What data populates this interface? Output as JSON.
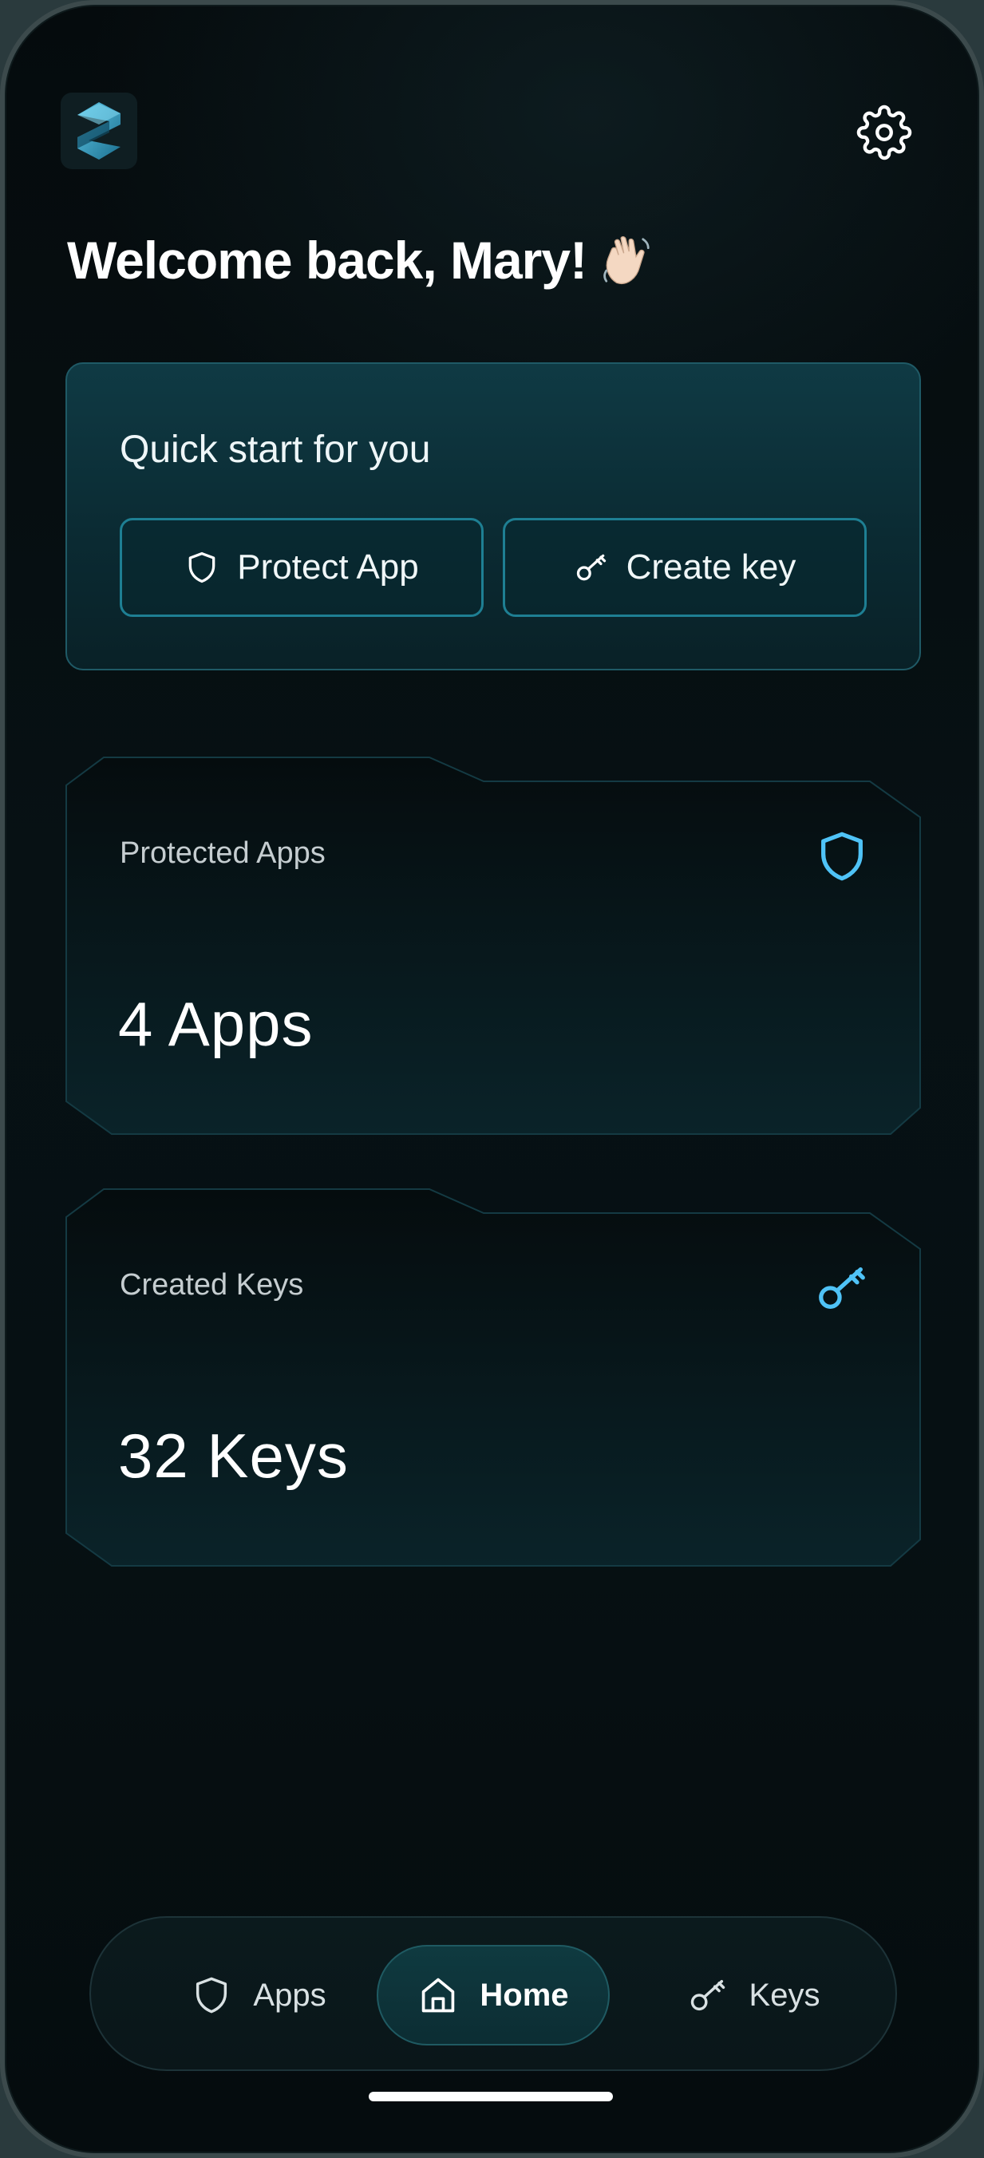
{
  "header": {
    "logo_icon": "shield-s-logo-icon",
    "settings_icon": "gear-icon",
    "welcome_text": "Welcome back, Mary!",
    "welcome_emoji_icon": "waving-hand-icon"
  },
  "quick_start": {
    "title": "Quick start for you",
    "protect_button": {
      "label": "Protect App",
      "icon": "shield-icon"
    },
    "create_button": {
      "label": "Create key",
      "icon": "key-icon"
    }
  },
  "stats": {
    "apps": {
      "label": "Protected Apps",
      "value": "4 Apps",
      "icon": "shield-icon"
    },
    "keys": {
      "label": "Created Keys",
      "value": "32 Keys",
      "icon": "key-icon"
    }
  },
  "bottom_nav": {
    "items": [
      {
        "label": "Apps",
        "icon": "shield-icon",
        "active": false
      },
      {
        "label": "Home",
        "icon": "house-icon",
        "active": true
      },
      {
        "label": "Keys",
        "icon": "key-icon",
        "active": false
      }
    ]
  },
  "colors": {
    "accent": "#4fc3f7",
    "card_border": "#1e7f93",
    "background": "#061013"
  }
}
